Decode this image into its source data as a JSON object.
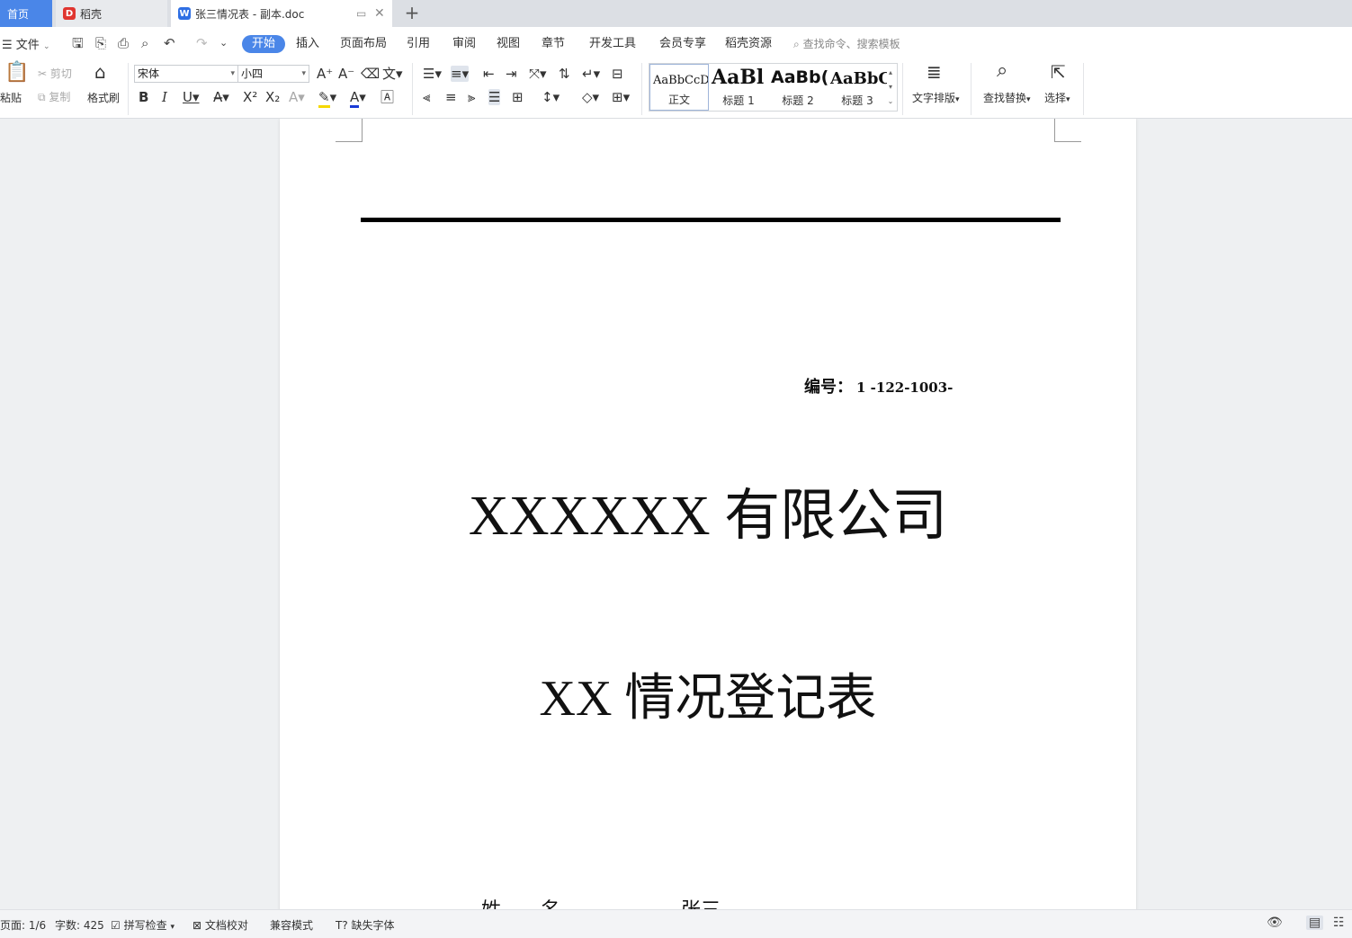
{
  "tabs": {
    "home": "首页",
    "daoke": "稻壳",
    "doc": "张三情况表 - 副本.doc"
  },
  "menu": {
    "file": "文件",
    "tabs": [
      "开始",
      "插入",
      "页面布局",
      "引用",
      "审阅",
      "视图",
      "章节",
      "开发工具",
      "会员专享",
      "稻壳资源"
    ],
    "active_tab": "开始",
    "search_placeholder": "查找命令、搜索模板"
  },
  "ribbon": {
    "paste": "粘贴",
    "cut": "剪切",
    "copy": "复制",
    "format_painter": "格式刷",
    "font_name": "宋体",
    "font_size": "小四",
    "styles": [
      {
        "sample": "AaBbCcDd",
        "name": "正文"
      },
      {
        "sample": "AaBl",
        "name": "标题 1"
      },
      {
        "sample": "AaBb(",
        "name": "标题 2"
      },
      {
        "sample": "AaBbC",
        "name": "标题 3"
      }
    ],
    "text_layout": "文字排版",
    "find_replace": "查找替换",
    "select": "选择"
  },
  "document": {
    "doc_number_label": "编号：",
    "doc_number_value": "1 -122-1003-",
    "company_title": "XXXXXX 有限公司",
    "form_title": "XX 情况登记表",
    "name_label": "姓　　名",
    "name_value": "张三"
  },
  "status": {
    "page": "页面: 1/6",
    "word_count": "字数: 425",
    "spell_check": "拼写检查",
    "proofread": "文档校对",
    "compat_mode": "兼容模式",
    "missing_font": "缺失字体"
  },
  "colors": {
    "accent": "#4a86e8",
    "page_bg": "#ffffff",
    "canvas_bg": "#eef0f2"
  }
}
